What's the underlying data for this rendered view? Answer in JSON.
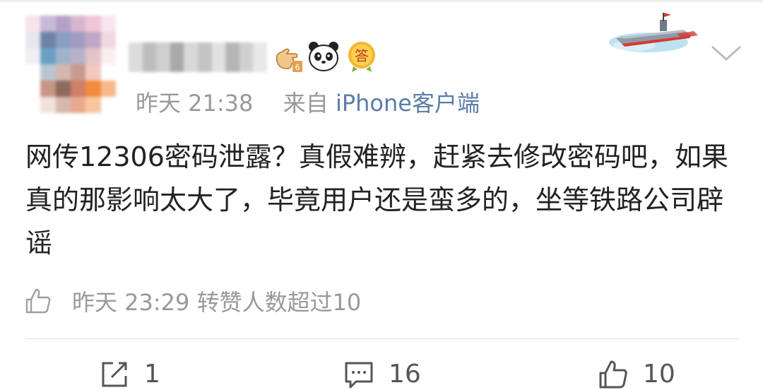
{
  "post": {
    "time": "昨天 21:38",
    "source_prefix": "来自",
    "source_client": "iPhone客户端",
    "badges": [
      "emoji-hand-badge",
      "panda-badge",
      "answer-badge"
    ],
    "answer_badge_text": "答",
    "text": "网传12306密码泄露？真假难辨，赶紧去修改密码吧，如果真的那影响太大了，毕竟用户还是蛮多的，坐等铁路公司辟谣"
  },
  "like_info": {
    "icon": "thumb-up-icon",
    "text": "昨天 23:29 转赞人数超过10"
  },
  "actions": {
    "repost": {
      "icon": "repost-icon",
      "count": "1"
    },
    "comment": {
      "icon": "comment-icon",
      "count": "16"
    },
    "like": {
      "icon": "thumb-up-icon",
      "count": "10"
    }
  },
  "colors": {
    "meta_gray": "#999999",
    "client_blue": "#5b7da8",
    "text": "#222222"
  }
}
